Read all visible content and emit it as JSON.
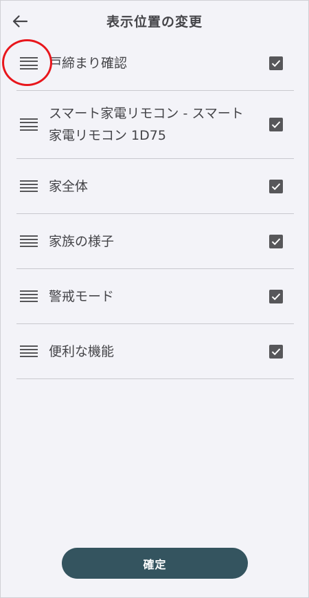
{
  "header": {
    "title": "表示位置の変更",
    "back_icon": "arrow-left-icon"
  },
  "items": [
    {
      "label": "戸締まり確認",
      "checked": true
    },
    {
      "label": "スマート家電リモコン - スマート家電リモコン 1D75",
      "checked": true
    },
    {
      "label": "家全体",
      "checked": true
    },
    {
      "label": "家族の様子",
      "checked": true
    },
    {
      "label": "警戒モード",
      "checked": true
    },
    {
      "label": "便利な機能",
      "checked": true
    }
  ],
  "footer": {
    "confirm_label": "確定"
  },
  "icons": {
    "drag": "drag-handle-icon",
    "check": "checkmark-icon"
  },
  "colors": {
    "background": "#f3f3f8",
    "text": "#444448",
    "checkbox": "#57575a",
    "confirm_button": "#34545f",
    "highlight": "#e8161c"
  }
}
